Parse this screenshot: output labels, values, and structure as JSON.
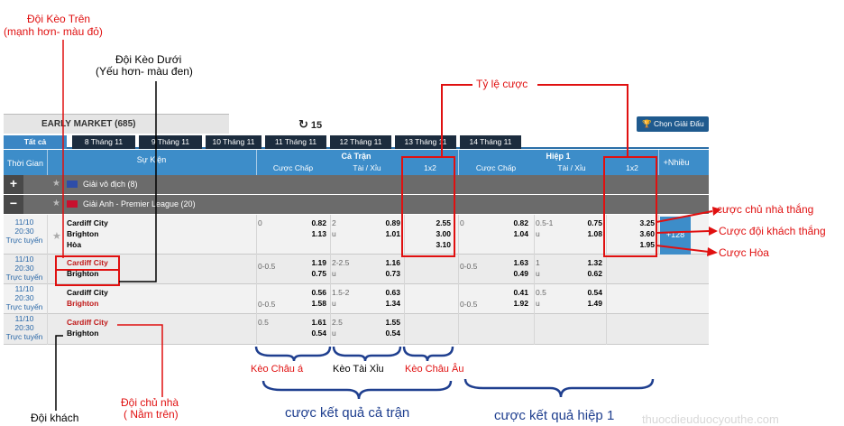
{
  "annotations": {
    "doi_keo_tren": "Đội Kèo Trên",
    "doi_keo_tren_sub": "(mạnh hơn- màu đỏ)",
    "doi_keo_duoi": "Đội Kèo Dưới",
    "doi_keo_duoi_sub": "(Yếu hơn- màu đen)",
    "ty_le_cuoc": "Tỷ lệ cược",
    "cuoc_chu_nha_thang": "cược chủ nhà thắng",
    "cuoc_doi_khach_thang": "Cược đội khách thắng",
    "cuoc_hoa": "Cược Hòa",
    "keo_chau_a": "Kèo Châu á",
    "keo_tai_xiu": "Kèo Tài Xỉu",
    "keo_chau_au": "Kèo Châu Âu",
    "doi_chu_nha": "Đội chủ nhà",
    "doi_chu_nha_sub": "( Nằm trên)",
    "doi_khach": "Đội khách",
    "cuoc_ket_qua_ca_tran": "cược kết quả cả trận",
    "cuoc_ket_qua_hiep_1": "cược kết quả hiệp 1"
  },
  "market": {
    "title": "EARLY MARKET (685)",
    "refresh_icon": "refresh-icon",
    "refresh_count": "15",
    "choose_league": "Chọn Giải Đấu",
    "trophy_icon": "trophy-icon"
  },
  "tabs": [
    "Tất cả",
    "8 Tháng 11",
    "9 Tháng 11",
    "10 Tháng 11",
    "11 Tháng 11",
    "12 Tháng 11",
    "13 Tháng 11",
    "14 Tháng 11"
  ],
  "columns": {
    "time": "Thời Gian",
    "event": "Sự Kiện",
    "full_match": "Cả Trận",
    "first_half": "Hiệp 1",
    "handicap": "Cược Chấp",
    "over_under": "Tài / Xỉu",
    "one_x_two": "1x2",
    "more": "+Nhiều"
  },
  "leagues": [
    {
      "sign": "+",
      "name": "Giải vô địch (8)"
    },
    {
      "sign": "−",
      "name": "Giải Anh - Premier League (20)"
    }
  ],
  "matches": [
    {
      "date": "11/10",
      "time": "20:30",
      "live": "Trực tuyến",
      "home": "Cardiff City",
      "away": "Brighton",
      "draw": "Hòa",
      "home_red": false,
      "ft_hdp": "0",
      "ft_hdp_home": "0.82",
      "ft_hdp_away": "1.13",
      "ft_ou": "2",
      "ft_ou_u": "u",
      "ft_over": "0.89",
      "ft_under": "1.01",
      "ft_1": "2.55",
      "ft_2": "3.00",
      "ft_x": "3.10",
      "h1_hdp": "0",
      "h1_hdp_home": "0.82",
      "h1_hdp_away": "1.04",
      "h1_ou": "0.5-1",
      "h1_ou_u": "u",
      "h1_over": "0.75",
      "h1_under": "1.08",
      "h1_1": "3.25",
      "h1_2": "3.60",
      "h1_x": "1.95",
      "more_count": "+128"
    },
    {
      "date": "11/10",
      "time": "20:30",
      "live": "Trực tuyến",
      "home": "Cardiff City",
      "away": "Brighton",
      "home_red": true,
      "ft_hdp": "0-0.5",
      "ft_hdp_home": "1.19",
      "ft_hdp_away": "0.75",
      "ft_ou": "2-2.5",
      "ft_ou_u": "u",
      "ft_over": "1.16",
      "ft_under": "0.73",
      "h1_hdp": "0-0.5",
      "h1_hdp_home": "1.63",
      "h1_hdp_away": "0.49",
      "h1_ou": "1",
      "h1_ou_u": "u",
      "h1_over": "1.32",
      "h1_under": "0.62"
    },
    {
      "date": "11/10",
      "time": "20:30",
      "live": "Trực tuyến",
      "home": "Cardiff City",
      "away": "Brighton",
      "home_red": false,
      "ft_hdp": "0-0.5",
      "ft_hdp_home": "0.56",
      "ft_hdp_away": "1.58",
      "ft_ou": "1.5-2",
      "ft_ou_u": "u",
      "ft_over": "0.63",
      "ft_under": "1.34",
      "h1_hdp": "0-0.5",
      "h1_hdp_home": "0.41",
      "h1_hdp_away": "1.92",
      "h1_ou": "0.5",
      "h1_ou_u": "u",
      "h1_over": "0.54",
      "h1_under": "1.49"
    },
    {
      "date": "11/10",
      "time": "20:30",
      "live": "Trực tuyến",
      "home": "Cardiff City",
      "away": "Brighton",
      "home_red": true,
      "ft_hdp": "0.5",
      "ft_hdp_home": "1.61",
      "ft_hdp_away": "0.54",
      "ft_ou": "2.5",
      "ft_ou_u": "u",
      "ft_over": "1.55",
      "ft_under": "0.54"
    }
  ],
  "colors": {
    "annotation_red": "#e01010",
    "header_blue": "#3d8dc9",
    "tab_dark": "#1c2c3e",
    "brace_blue": "#1f3f8f"
  },
  "watermark": "thuocdieuduocyouthe.com"
}
